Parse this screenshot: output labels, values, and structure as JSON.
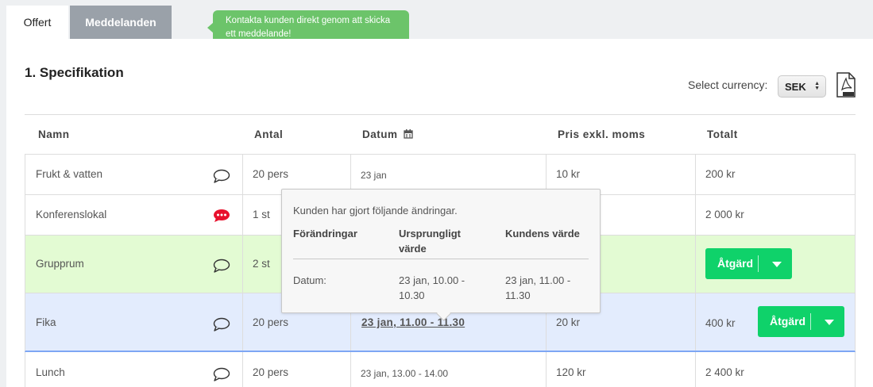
{
  "tabs": {
    "offert": "Offert",
    "meddelanden": "Meddelanden"
  },
  "green_tip": "Kontakta kunden direkt genom att skicka ett meddelande!",
  "section_title": "1. Specifikation",
  "currency": {
    "label": "Select currency:",
    "value": "SEK"
  },
  "table": {
    "headers": {
      "namn": "Namn",
      "antal": "Antal",
      "datum": "Datum",
      "pris": "Pris exkl. moms",
      "totalt": "Totalt"
    },
    "rows": [
      {
        "namn": "Frukt & vatten",
        "antal": "20 pers",
        "datum": "23 jan",
        "pris": "10 kr",
        "totalt": "200 kr"
      },
      {
        "namn": "Konferenslokal",
        "antal": "1 st",
        "datum": "",
        "pris": "",
        "totalt": "2 000 kr"
      },
      {
        "namn": "Grupprum",
        "antal": "2 st",
        "datum": "",
        "pris": "",
        "totalt": ""
      },
      {
        "namn": "Fika",
        "antal": "20 pers",
        "datum": "23 jan, 11.00 - 11.30",
        "pris": "20 kr",
        "totalt": "400 kr"
      },
      {
        "namn": "Lunch",
        "antal": "20 pers",
        "datum": "23 jan, 13.00 - 14.00",
        "pris": "120 kr",
        "totalt": "2 400 kr"
      }
    ],
    "action_label": "Åtgärd"
  },
  "popover": {
    "intro": "Kunden har gjort följande ändringar.",
    "col_changes": "Förändringar",
    "col_original": "Ursprungligt värde",
    "col_customer": "Kundens värde",
    "field": "Datum:",
    "original_value": "23 jan, 10.00 - 10.30",
    "customer_value": "23 jan, 11.00 - 11.30"
  },
  "colors": {
    "green_tip": "#6cc46a",
    "action_button": "#0fd26a",
    "row_changed_green": "#e3fbd3",
    "row_selected_blue": "#e3ecfd",
    "unread_comment": "#e8112d"
  },
  "icons": {
    "comment": "speech-bubble-icon",
    "unread_comment": "speech-bubble-dots-icon",
    "calendar": "calendar-icon",
    "pdf": "pdf-file-icon"
  }
}
